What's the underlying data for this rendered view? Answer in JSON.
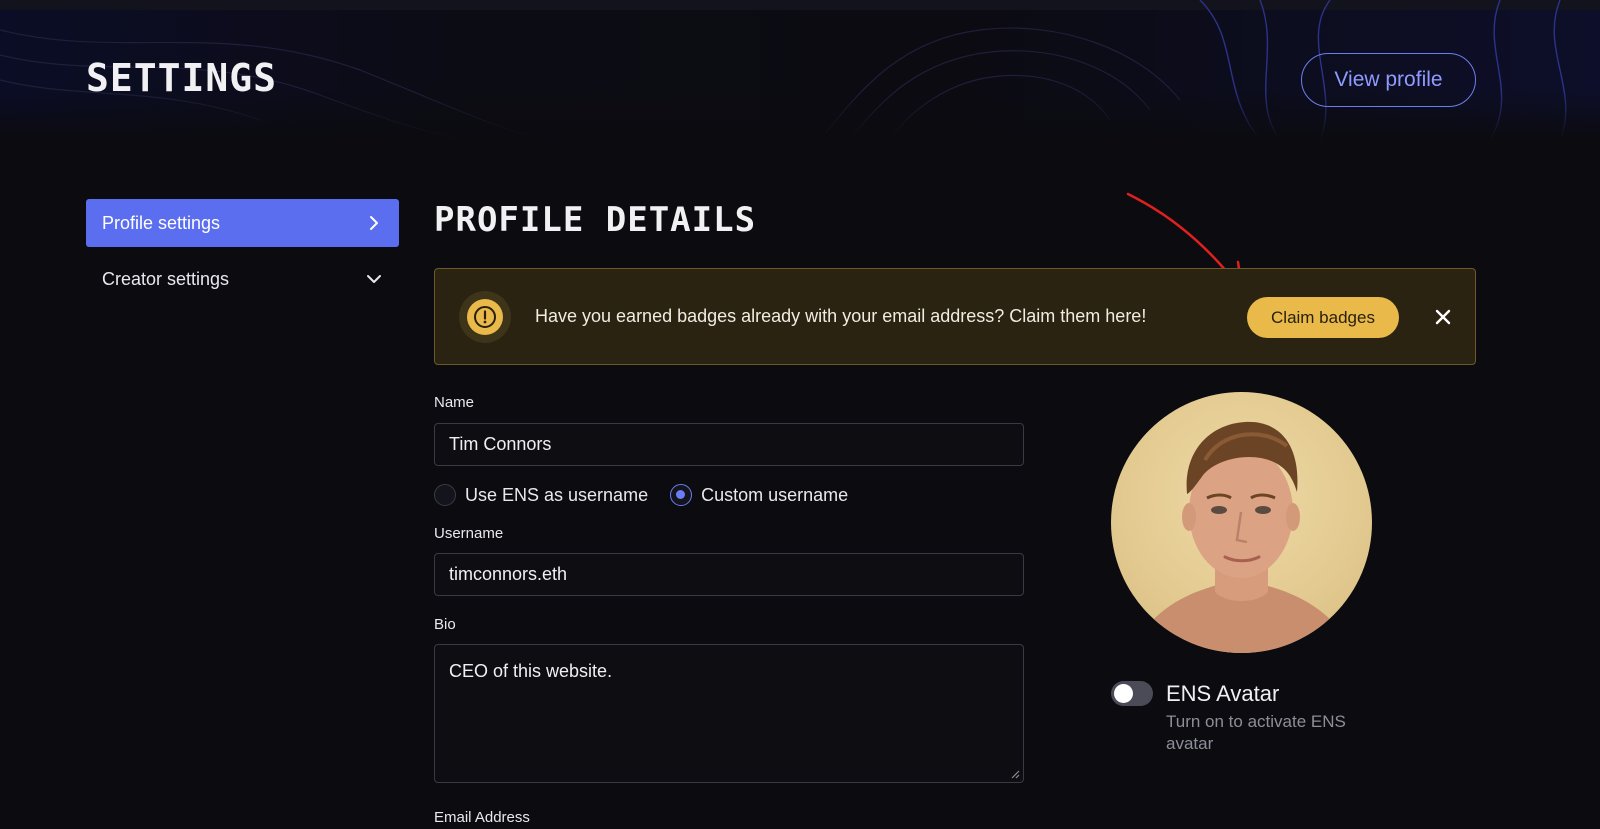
{
  "header": {
    "title": "SETTINGS",
    "view_profile_label": "View profile"
  },
  "sidebar": {
    "items": [
      {
        "label": "Profile settings",
        "icon": "chevron-right-icon",
        "active": true
      },
      {
        "label": "Creator settings",
        "icon": "chevron-down-icon",
        "active": false
      }
    ]
  },
  "main": {
    "section_title": "PROFILE DETAILS",
    "banner": {
      "icon": "alert-circle-icon",
      "message": "Have you earned badges already with your email address? Claim them here!",
      "claim_label": "Claim badges",
      "close_icon": "close-icon",
      "annotation": "red-arrow-icon"
    },
    "form": {
      "name_label": "Name",
      "name_value": "Tim Connors",
      "username_options": [
        {
          "label": "Use ENS as username",
          "checked": false
        },
        {
          "label": "Custom username",
          "checked": true
        }
      ],
      "username_label": "Username",
      "username_value": "timconnors.eth",
      "bio_label": "Bio",
      "bio_value": "CEO of this website.",
      "email_label": "Email Address"
    },
    "avatar_panel": {
      "toggle_on": false,
      "ens_title": "ENS Avatar",
      "ens_description": "Turn on to activate ENS avatar"
    }
  },
  "colors": {
    "accent": "#5c6ef0",
    "banner_bg": "#2a2311",
    "banner_accent": "#e9b949",
    "annotation_red": "#e0201f"
  }
}
